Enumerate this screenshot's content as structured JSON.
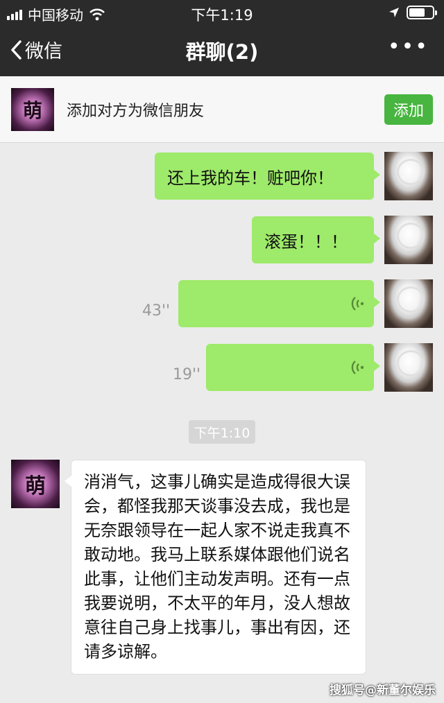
{
  "status_bar": {
    "carrier": "中国移动",
    "time": "下午1:19",
    "battery_level": 0.7
  },
  "nav": {
    "back_label": "微信",
    "title": "群聊(2)",
    "more": "•••"
  },
  "banner": {
    "avatar_text": "萌",
    "text": "添加对方为微信朋友",
    "add_label": "添加"
  },
  "messages": {
    "m1": "还上我的车！赃吧你！",
    "m2": "滚蛋！！！",
    "v1_duration": "43''",
    "v2_duration": "19''",
    "time": "下午1:10",
    "m3_avatar_text": "萌",
    "m3": "消消气，这事儿确实是造成得很大误会，都怪我那天谈事没去成，我也是无奈跟领导在一起人家不说走我真不敢动地。我马上联系媒体跟他们说名此事，让他们主动发声明。还有一点我要说明，不太平的年月，没人想故意往自己身上找事儿，事出有因，还请多谅解。"
  },
  "watermark": "搜狐号@新董尔娱乐",
  "colors": {
    "bubble_green": "#9eea6a",
    "add_button": "#47b53f",
    "nav_bg": "#2b2b2b",
    "chat_bg": "#ebebeb"
  },
  "icons": {
    "back": "chevron-left-icon",
    "wifi": "wifi-icon",
    "location": "location-arrow-icon",
    "voice": "voice-wave-icon"
  }
}
